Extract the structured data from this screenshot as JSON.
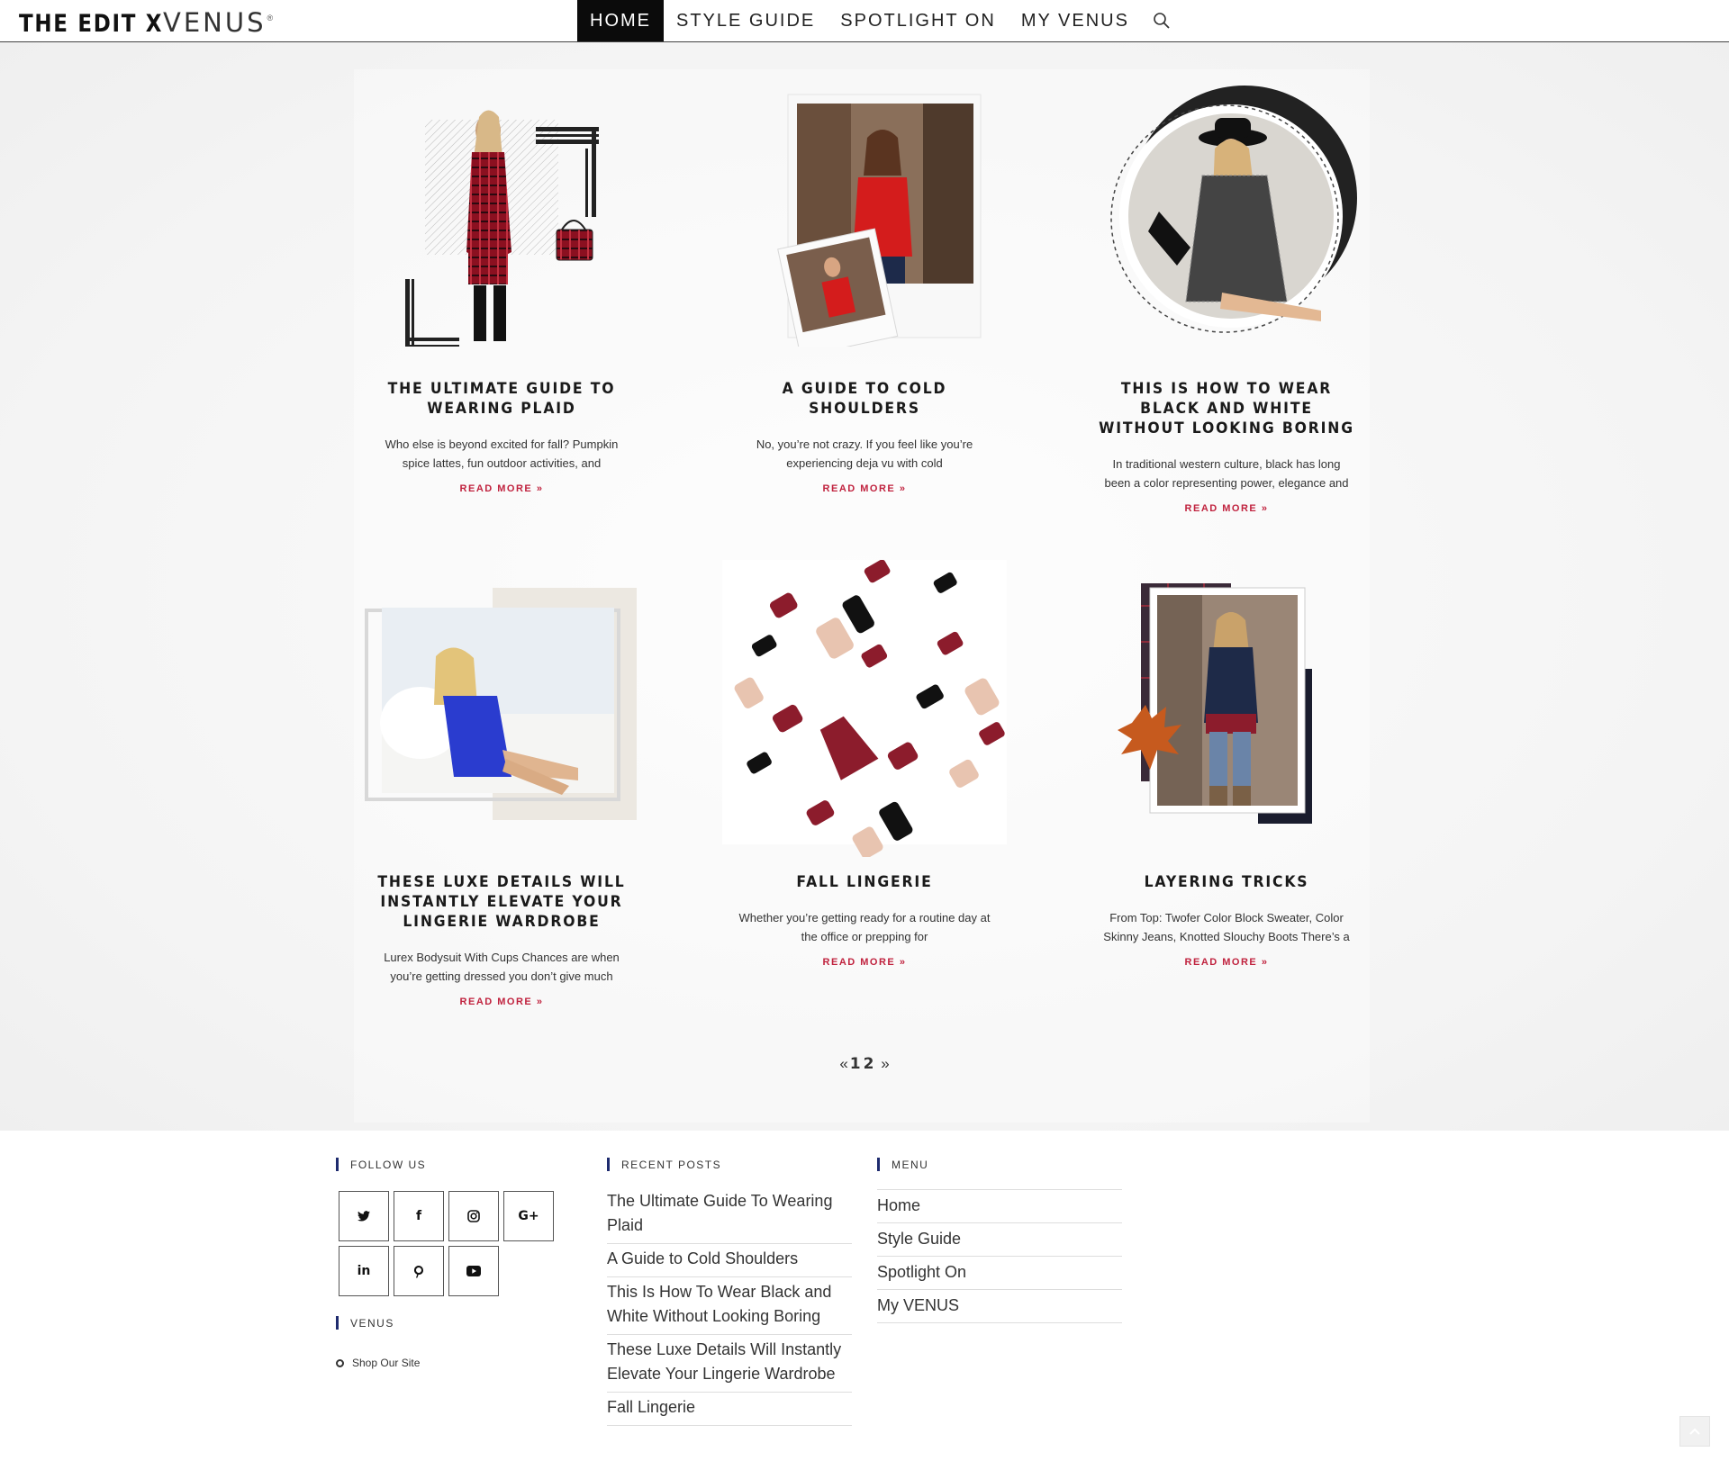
{
  "header": {
    "logo_bold": "THE EDIT X",
    "logo_light": "VENUS",
    "logo_mark": "®",
    "nav": [
      {
        "label": "HOME",
        "active": true
      },
      {
        "label": "STYLE GUIDE",
        "active": false
      },
      {
        "label": "SPOTLIGHT ON",
        "active": false
      },
      {
        "label": "MY VENUS",
        "active": false
      }
    ],
    "search_icon": "search-icon"
  },
  "posts": [
    {
      "title": "THE ULTIMATE GUIDE TO WEARING PLAID",
      "excerpt": "Who else is beyond excited for fall? Pumpkin spice lattes, fun outdoor activities, and",
      "read_more": "READ MORE »",
      "image": "plaid-dress-collage"
    },
    {
      "title": "A GUIDE TO COLD SHOULDERS",
      "excerpt": "No, you’re not crazy. If you feel like you’re experiencing deja vu with cold",
      "read_more": "READ MORE »",
      "image": "cold-shoulder-polaroids"
    },
    {
      "title": "THIS IS HOW TO WEAR BLACK AND WHITE WITHOUT LOOKING BORING",
      "excerpt": "In traditional western culture, black has long been a color representing power, elegance and",
      "read_more": "READ MORE »",
      "image": "black-white-circle"
    },
    {
      "title": "THESE LUXE DETAILS WILL INSTANTLY ELEVATE YOUR LINGERIE WARDROBE",
      "excerpt": "Lurex Bodysuit With Cups Chances are when you’re getting dressed you don’t give much",
      "read_more": "READ MORE »",
      "image": "blue-bodysuit"
    },
    {
      "title": "FALL LINGERIE",
      "excerpt": "Whether you’re getting ready for a routine day at the office or prepping for",
      "read_more": "READ MORE »",
      "image": "lingerie-pattern"
    },
    {
      "title": "LAYERING TRICKS",
      "excerpt": "From Top: Twofer Color Block Sweater, Color Skinny Jeans, Knotted Slouchy Boots There’s a",
      "read_more": "READ MORE »",
      "image": "layering-street"
    }
  ],
  "pagination": {
    "prev": "«",
    "pages": [
      "1",
      "2"
    ],
    "next": "»"
  },
  "footer": {
    "follow_title": "FOLLOW US",
    "social": [
      "twitter-icon",
      "facebook-icon",
      "instagram-icon",
      "google-plus-icon",
      "linkedin-icon",
      "pinterest-icon",
      "youtube-icon"
    ],
    "venus_title": "VENUS",
    "venus_link": "Shop Our Site",
    "recent_title": "RECENT POSTS",
    "recent_posts": [
      "The Ultimate Guide To Wearing Plaid",
      "A Guide to Cold Shoulders",
      "This Is How To Wear Black and White Without Looking Boring",
      "These Luxe Details Will Instantly Elevate Your Lingerie Wardrobe",
      "Fall Lingerie"
    ],
    "menu_title": "MENU",
    "menu": [
      "Home",
      "Style Guide",
      "Spotlight On",
      "My VENUS"
    ]
  },
  "colors": {
    "accent": "#c0223e",
    "widget_bar": "#1e2b6e",
    "nav_active": "#0b0b0b"
  }
}
